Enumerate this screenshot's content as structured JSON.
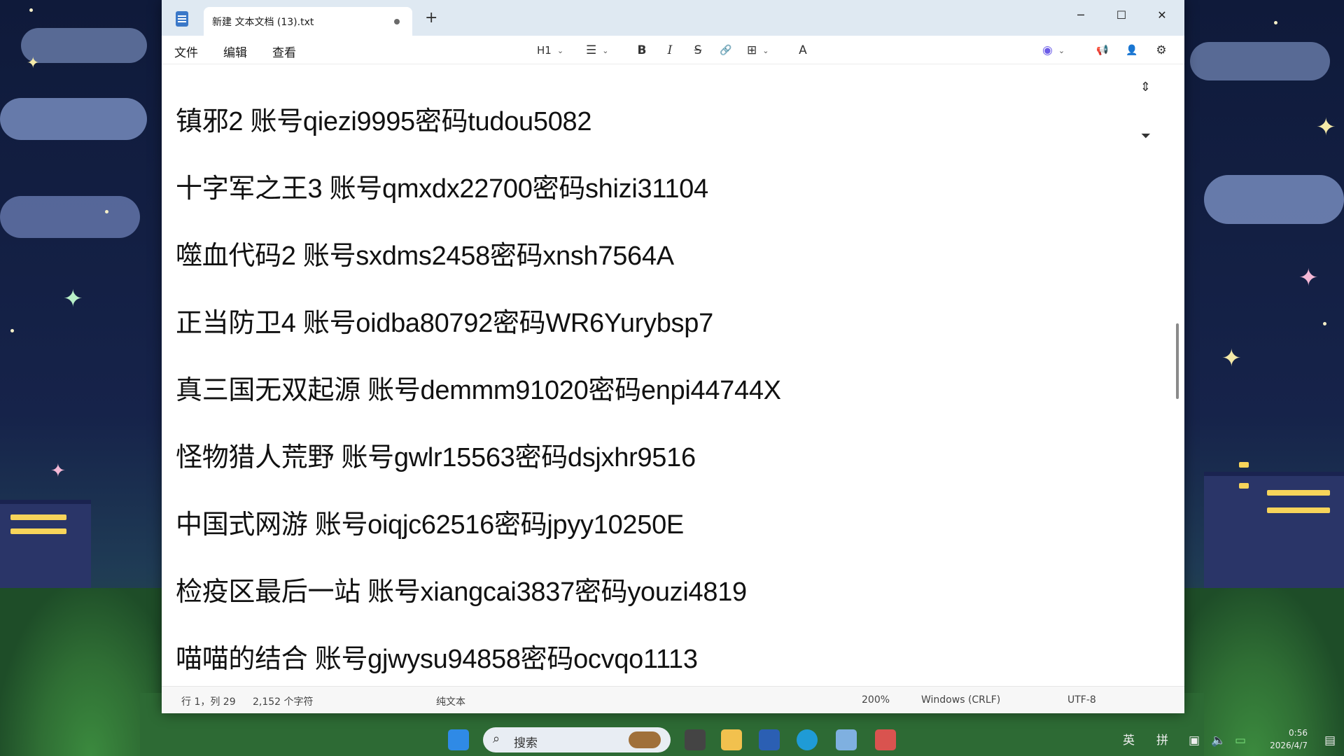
{
  "window": {
    "tab_title": "新建 文本文档 (13).txt",
    "new_tab": "+",
    "minimize": "─",
    "maximize": "☐",
    "close": "✕"
  },
  "menubar": {
    "file": "文件",
    "edit": "编辑",
    "view": "查看"
  },
  "toolbar": {
    "heading": "H1",
    "list": "☰",
    "bold": "B",
    "italic": "I",
    "strike": "S",
    "link": "🔗",
    "table": "⊞",
    "spell": "A",
    "copilot": "◉",
    "share": "📢",
    "account": "👤",
    "settings": "⚙"
  },
  "editor": {
    "lines": [
      "镇邪2 账号qiezi9995密码tudou5082",
      "十字军之王3 账号qmxdx22700密码shizi31104",
      "噬血代码2 账号sxdms2458密码xnsh7564A",
      "正当防卫4 账号oidba80792密码WR6Yurybsp7",
      "真三国无双起源 账号demmm91020密码enpi44744X",
      "怪物猎人荒野 账号gwlr15563密码dsjxhr9516",
      "中国式网游 账号oiqjc62516密码jpyy10250E",
      "检疫区最后一站 账号xiangcai3837密码youzi4819",
      "喵喵的结合 账号gjwysu94858密码ocvqo1113"
    ],
    "scroll_up": "⇕",
    "scroll_down": "⏷"
  },
  "status": {
    "position": "行 1，列 29",
    "chars": "2,152 个字符",
    "format": "纯文本",
    "zoom": "200%",
    "line_ending": "Windows (CRLF)",
    "encoding": "UTF-8"
  },
  "taskbar": {
    "search_placeholder": "搜索",
    "ime_lang": "英",
    "ime_mode": "拼",
    "time": "0:56",
    "date": "2026/4/7"
  }
}
